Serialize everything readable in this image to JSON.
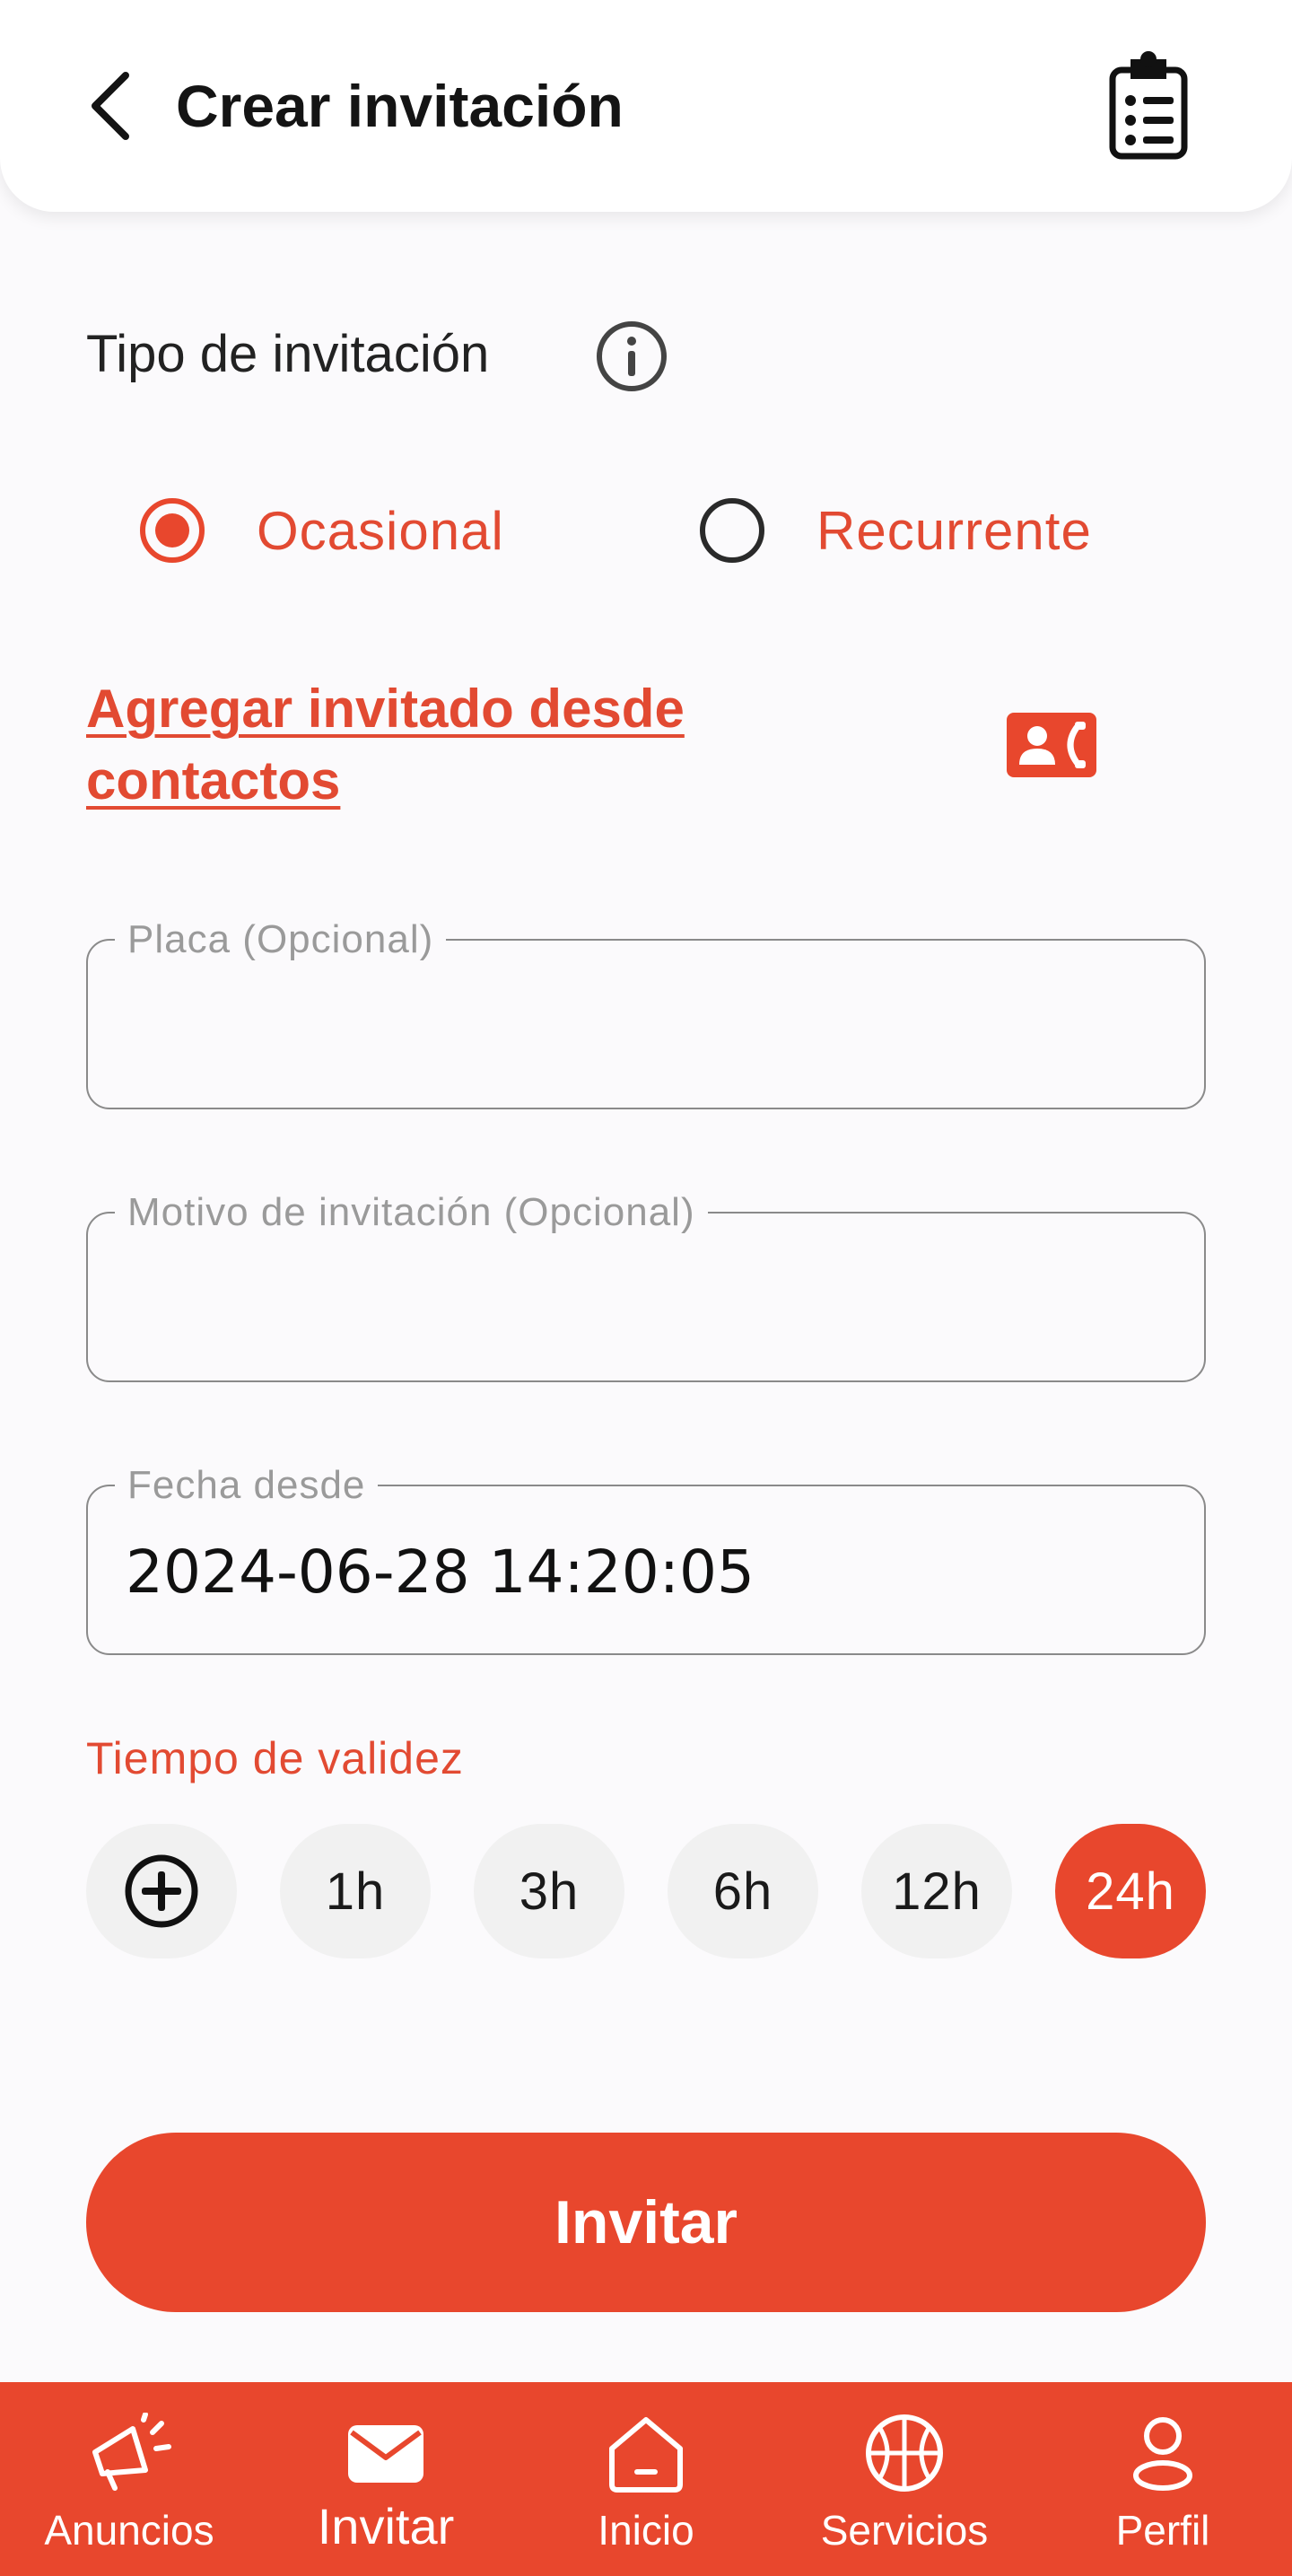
{
  "header": {
    "title": "Crear invitación",
    "back_icon": "chevron-left-icon",
    "action_icon": "clipboard-list-icon"
  },
  "invitation_type": {
    "label": "Tipo de invitación",
    "info_icon": "info-circle-icon",
    "options": [
      {
        "label": "Ocasional",
        "selected": true
      },
      {
        "label": "Recurrente",
        "selected": false
      }
    ]
  },
  "contacts": {
    "link_text": "Agregar invitado desde contactos",
    "icon": "contact-phone-icon"
  },
  "fields": {
    "placa": {
      "label": "Placa (Opcional)",
      "value": ""
    },
    "motivo": {
      "label": "Motivo de invitación (Opcional)",
      "value": ""
    },
    "fecha": {
      "label": "Fecha desde",
      "value": "2024-06-28 14:20:05"
    }
  },
  "validity": {
    "label": "Tiempo de validez",
    "add_icon": "plus-circle-icon",
    "options": [
      "1h",
      "3h",
      "6h",
      "12h",
      "24h"
    ],
    "selected": "24h"
  },
  "invite_button": "Invitar",
  "bottom_nav": [
    {
      "label": "Anuncios",
      "icon": "megaphone-icon",
      "active": false
    },
    {
      "label": "Invitar",
      "icon": "envelope-icon",
      "active": true
    },
    {
      "label": "Inicio",
      "icon": "home-icon",
      "active": false
    },
    {
      "label": "Servicios",
      "icon": "basketball-icon",
      "active": false
    },
    {
      "label": "Perfil",
      "icon": "user-icon",
      "active": false
    }
  ],
  "colors": {
    "accent": "#e8472d",
    "accent_text": "#e24a32",
    "background": "#fbfafc",
    "chip_bg": "#f1f1f1"
  }
}
